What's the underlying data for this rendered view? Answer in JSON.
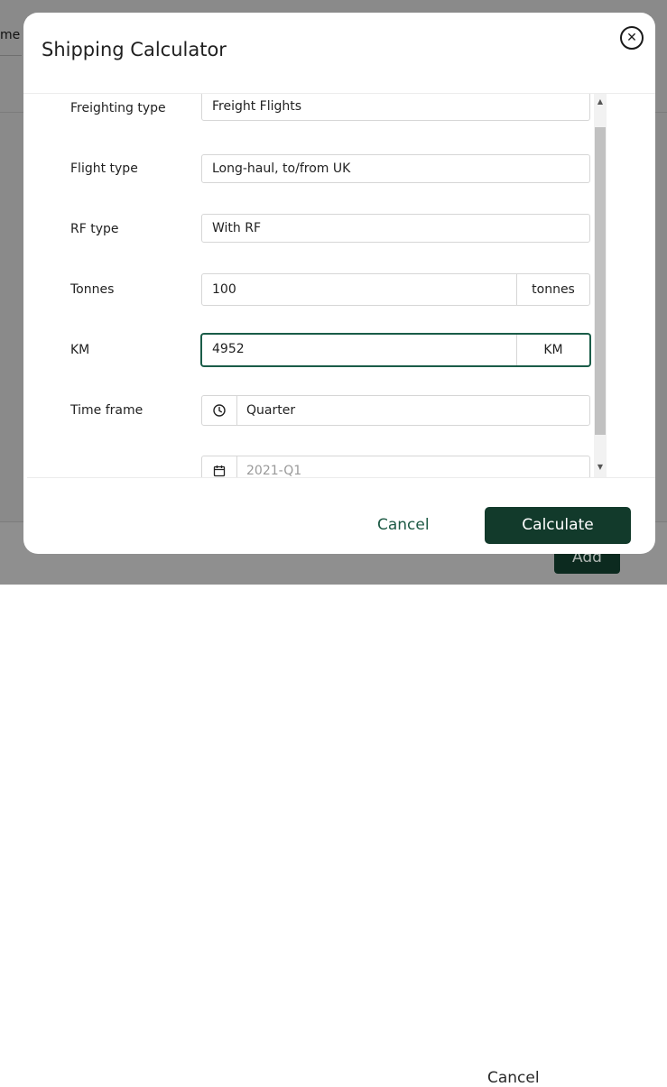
{
  "background": {
    "tab_fragment": "me",
    "footer": {
      "cancel_label": "Cancel",
      "add_label": "Add"
    }
  },
  "modal": {
    "title": "Shipping Calculator",
    "close_icon": "close-circle-icon",
    "fields": {
      "freighting_type": {
        "label": "Freighting type",
        "value": "Freight Flights"
      },
      "flight_type": {
        "label": "Flight type",
        "value": "Long-haul, to/from UK"
      },
      "rf_type": {
        "label": "RF type",
        "value": "With RF"
      },
      "tonnes": {
        "label": "Tonnes",
        "value": "100",
        "unit": "tonnes"
      },
      "km": {
        "label": "KM",
        "value": "4952",
        "unit": "KM"
      },
      "time_frame": {
        "label": "Time frame",
        "value": "Quarter",
        "icon": "clock-icon"
      },
      "period": {
        "value": "2021-Q1",
        "icon": "calendar-icon"
      }
    },
    "footer": {
      "cancel_label": "Cancel",
      "calculate_label": "Calculate"
    }
  },
  "colors": {
    "accent": "#123a2b",
    "focus": "#1a5c48",
    "link": "#1d5a45"
  }
}
